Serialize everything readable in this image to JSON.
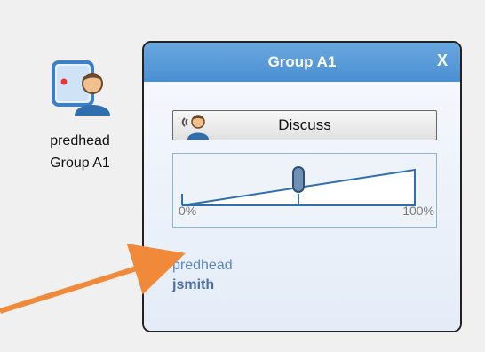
{
  "desktop_icon": {
    "name_line1": "predhead",
    "name_line2": "Group A1",
    "icon": "presenter-user-icon"
  },
  "window": {
    "title": "Group A1",
    "close_label": "X",
    "discuss_button_label": "Discuss",
    "slider": {
      "min_label": "0%",
      "max_label": "100%",
      "value_percent": 50
    },
    "users": [
      "predhead",
      "jsmith"
    ]
  },
  "colors": {
    "titlebar": "#4a8fd3",
    "accent_arrow": "#f08a3a",
    "user_link": "#5a87c6"
  }
}
